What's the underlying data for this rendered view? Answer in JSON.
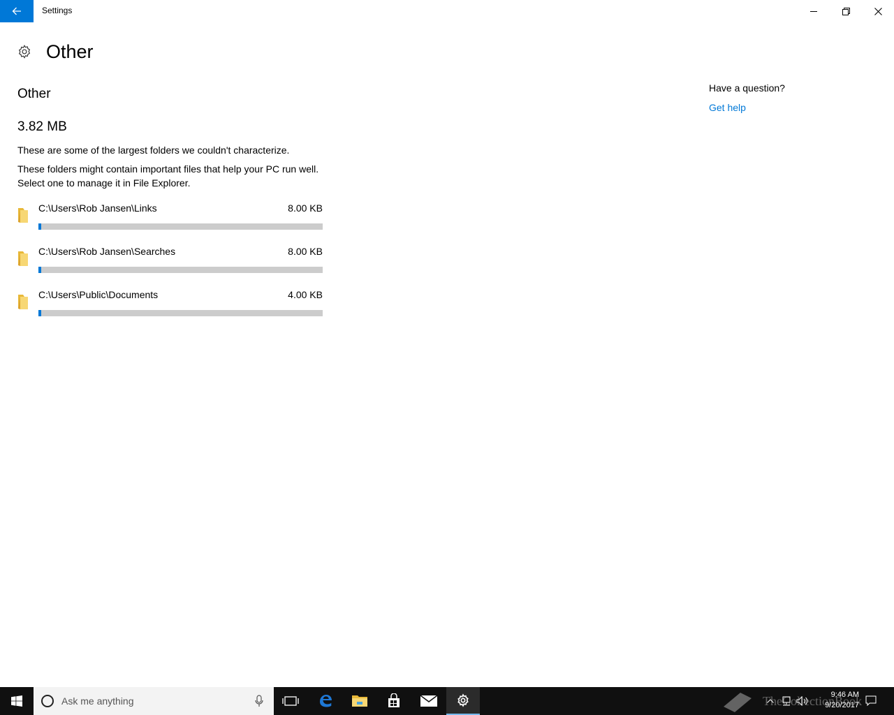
{
  "window": {
    "app_title": "Settings"
  },
  "page": {
    "title": "Other",
    "section_title": "Other",
    "total_size": "3.82 MB",
    "description_1": "These are some of the largest folders we couldn't characterize.",
    "description_2": "These folders might contain important files that help your PC run well. Select one to manage it in File Explorer."
  },
  "folders": [
    {
      "path": "C:\\Users\\Rob Jansen\\Links",
      "size": "8.00 KB",
      "usage_fraction": 0.01
    },
    {
      "path": "C:\\Users\\Rob Jansen\\Searches",
      "size": "8.00 KB",
      "usage_fraction": 0.01
    },
    {
      "path": "C:\\Users\\Public\\Documents",
      "size": "4.00 KB",
      "usage_fraction": 0.01
    }
  ],
  "help": {
    "question": "Have a question?",
    "link": "Get help"
  },
  "taskbar": {
    "search_placeholder": "Ask me anything",
    "time": "9:46 AM",
    "date": "9/20/2017",
    "watermark": "TheCollectionBook"
  },
  "colors": {
    "accent": "#0078d7",
    "bar_track": "#cccccc",
    "taskbar": "#101010"
  }
}
